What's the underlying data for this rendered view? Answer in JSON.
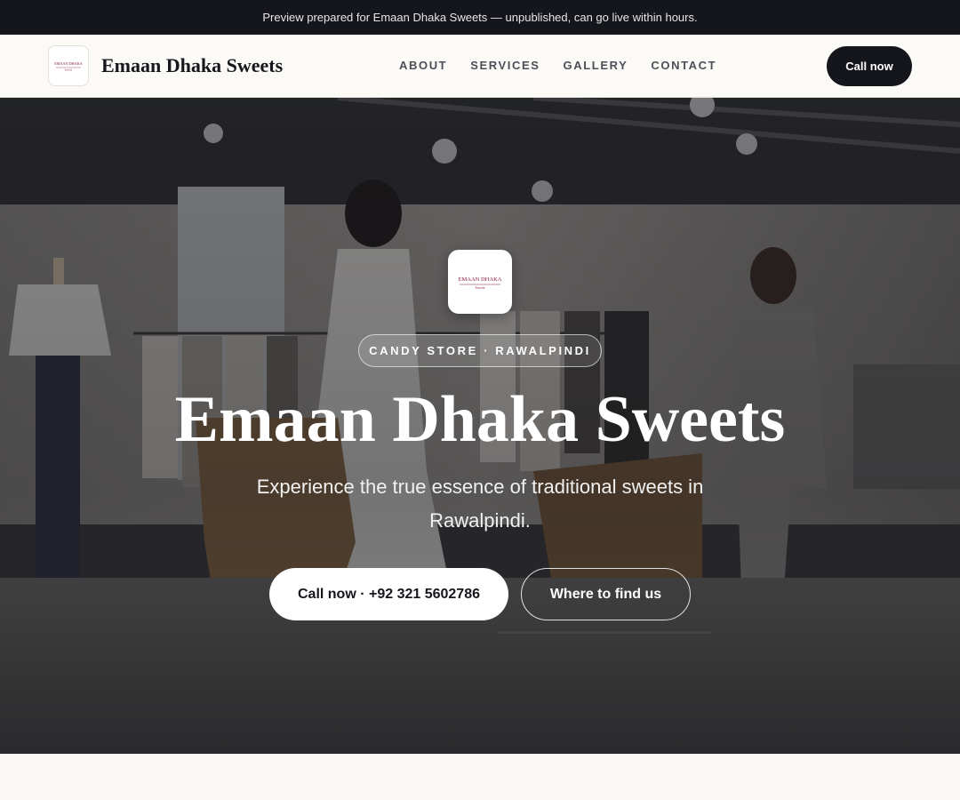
{
  "preview_banner": {
    "text": "Preview prepared for Emaan Dhaka Sweets — unpublished, can go live within hours."
  },
  "header": {
    "brand_name": "Emaan Dhaka Sweets",
    "nav": [
      "ABOUT",
      "SERVICES",
      "GALLERY",
      "CONTACT"
    ],
    "call_label": "Call now"
  },
  "logo": {
    "line1": "EMAAN DHAKA",
    "line2": "Sweets",
    "accent_color": "#8b1c3a"
  },
  "hero": {
    "tag": "CANDY STORE · RAWALPINDI",
    "title": "Emaan Dhaka Sweets",
    "subtitle": "Experience the true essence of traditional sweets in Rawalpindi.",
    "primary_button": "Call now · +92 321 5602786",
    "secondary_button": "Where to find us",
    "background_image": "clothing-store-interior-photo"
  },
  "colors": {
    "dark": "#14161b",
    "page_bg": "#faf8f4"
  }
}
